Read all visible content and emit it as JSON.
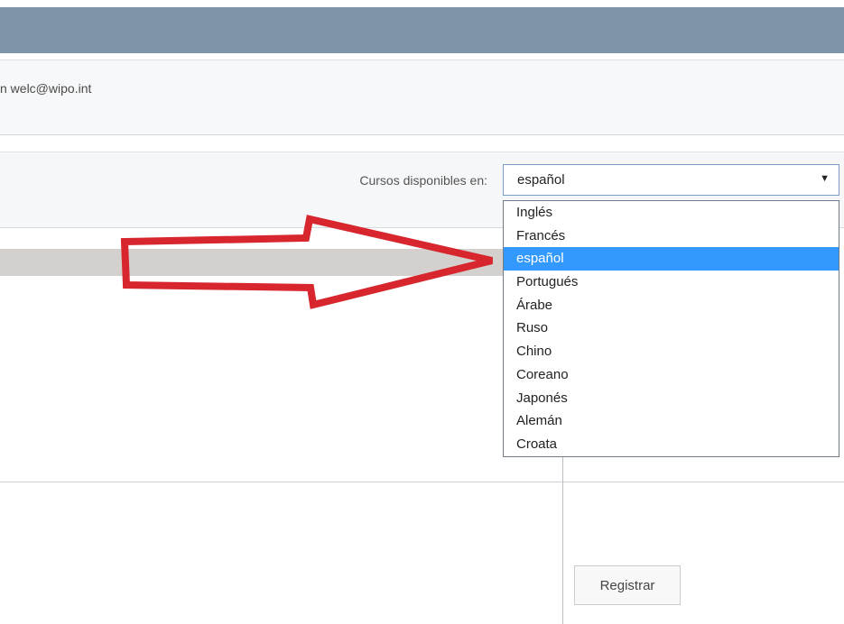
{
  "header": {
    "email_text": "n welc@wipo.int"
  },
  "filter": {
    "label": "Cursos disponibles en:",
    "selected_value": "español",
    "caret_icon": "▼"
  },
  "dropdown": {
    "options": [
      "Inglés",
      "Francés",
      "español",
      "Portugués",
      "Árabe",
      "Ruso",
      "Chino",
      "Coreano",
      "Japonés",
      "Alemán",
      "Croata"
    ],
    "highlighted_index": 2
  },
  "actions": {
    "register_label": "Registrar"
  },
  "annotation": {
    "arrow_icon": "red-arrow-outline",
    "arrow_color": "#d7262d"
  },
  "colors": {
    "header_bar": "#7e95a9",
    "selection_highlight": "#3399ff"
  }
}
